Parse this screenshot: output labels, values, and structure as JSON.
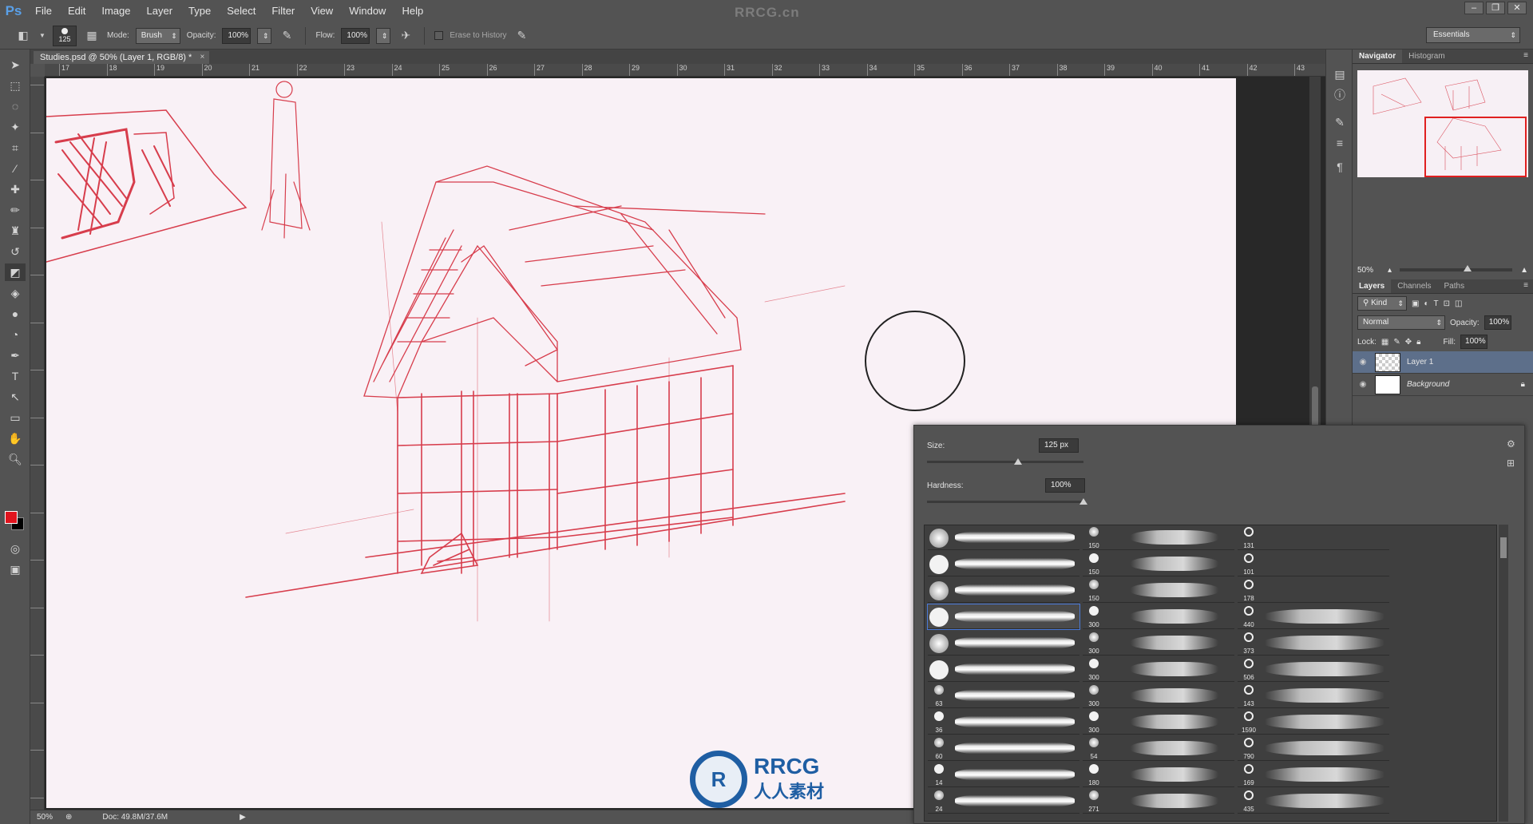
{
  "app": {
    "logo": "Ps",
    "site_mark": "RRCG.cn"
  },
  "menu": [
    "File",
    "Edit",
    "Image",
    "Layer",
    "Type",
    "Select",
    "Filter",
    "View",
    "Window",
    "Help"
  ],
  "window_controls": [
    "–",
    "❐",
    "✕"
  ],
  "options": {
    "brush_size": "125",
    "mode_label": "Mode:",
    "mode_value": "Brush",
    "opacity_label": "Opacity:",
    "opacity_value": "100%",
    "flow_label": "Flow:",
    "flow_value": "100%",
    "erase_history_label": "Erase to History",
    "workspace": "Essentials"
  },
  "document": {
    "tab_title": "Studies.psd @ 50% (Layer 1, RGB/8) *",
    "close": "×"
  },
  "ruler_ticks": [
    "17",
    "18",
    "19",
    "20",
    "21",
    "22",
    "23",
    "24",
    "25",
    "26",
    "27",
    "28",
    "29",
    "30",
    "31",
    "32",
    "33",
    "34",
    "35",
    "36",
    "37",
    "38",
    "39",
    "40",
    "41",
    "42",
    "43"
  ],
  "status": {
    "zoom": "50%",
    "doc_size": "Doc: 49.8M/37.6M"
  },
  "colors": {
    "foreground": "#e0141e",
    "background": "#000000",
    "sketch_red": "#d42a3a"
  },
  "navigator": {
    "tabs": [
      "Navigator",
      "Histogram"
    ],
    "zoom": "50%"
  },
  "layers_panel": {
    "tabs": [
      "Layers",
      "Channels",
      "Paths"
    ],
    "filter_kind": "Kind",
    "blend_mode": "Normal",
    "opacity_label": "Opacity:",
    "opacity_value": "100%",
    "lock_label": "Lock:",
    "fill_label": "Fill:",
    "fill_value": "100%",
    "layers": [
      {
        "name": "Layer 1",
        "selected": true
      },
      {
        "name": "Background",
        "selected": false
      }
    ]
  },
  "brush_picker": {
    "size_label": "Size:",
    "size_value": "125 px",
    "size_pct": 0.58,
    "hardness_label": "Hardness:",
    "hardness_value": "100%",
    "hardness_pct": 1.0,
    "col1": [
      "",
      "",
      "",
      "",
      "",
      "",
      "63",
      "36",
      "60",
      "14",
      "24"
    ],
    "col2": [
      "150",
      "150",
      "150",
      "300",
      "300",
      "300",
      "300",
      "300",
      "54",
      "180",
      "271"
    ],
    "col3": [
      "131",
      "101",
      "178",
      "440",
      "373",
      "506",
      "143",
      "1590",
      "790",
      "169",
      "435"
    ]
  },
  "watermark": {
    "brand": "RRCG",
    "sub": "人人素材"
  }
}
